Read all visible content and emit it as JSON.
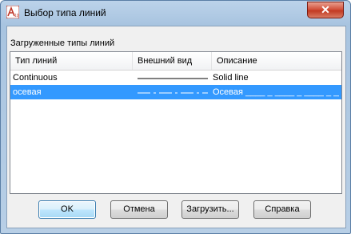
{
  "window": {
    "title": "Выбор типа линий",
    "close_label": "✕"
  },
  "group": {
    "label": "Загруженные типы линий"
  },
  "table": {
    "columns": [
      "Тип линий",
      "Внешний вид",
      "Описание"
    ],
    "rows": [
      {
        "name": "Continuous",
        "description": "Solid line",
        "selected": false
      },
      {
        "name": "осевая",
        "description": "Осевая ____ _ ____ _ ____ _ ____ _",
        "selected": true
      }
    ]
  },
  "scrollbar": {
    "left_icon": "◀",
    "right_icon": "▶",
    "grip": "|||"
  },
  "buttons": {
    "ok": "OK",
    "cancel": "Отмена",
    "load": "Загрузить...",
    "help": "Справка"
  }
}
